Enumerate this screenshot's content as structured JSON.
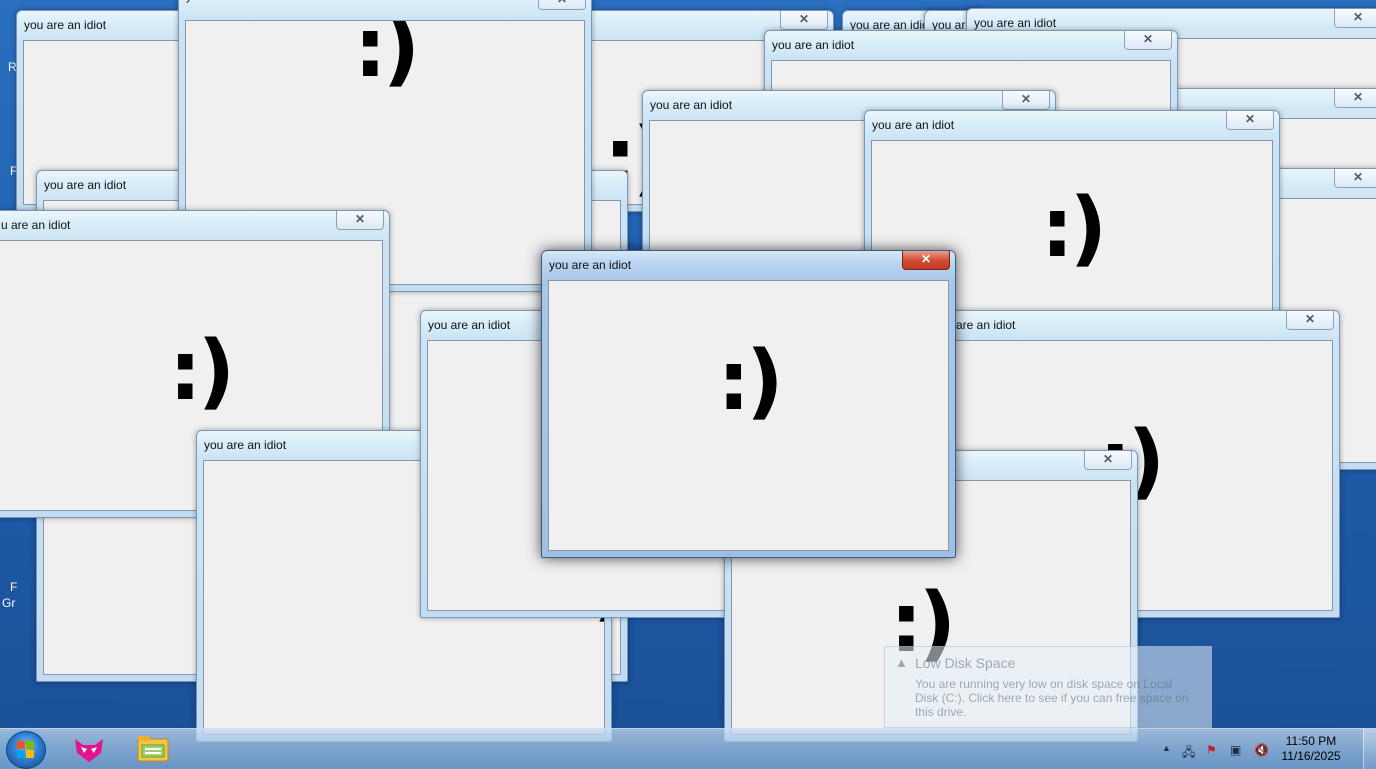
{
  "window_title": "you are an idiot",
  "partial_title": "u are an idiot",
  "partial_title_b": "are an idiot",
  "partial_title_c": "you are an id",
  "smiley": ":)",
  "close_glyph": "✕",
  "notification": {
    "title": "Low Disk Space",
    "body": "You are running very low on disk space on Local Disk (C:). Click here to see if you can free space on this drive."
  },
  "clock": {
    "time": "11:50 PM",
    "date": "11/16/2025"
  },
  "taskbar": {
    "apps": [
      "firefox-icon",
      "file-explorer-icon"
    ]
  },
  "tray": {
    "overflow": "▲"
  },
  "desktop_fragments": [
    "R",
    "F",
    "F",
    "Gr"
  ],
  "colors": {
    "active_close": "#c03a22",
    "client": "#f0f0f0",
    "desktop": "#1e5aa8"
  }
}
